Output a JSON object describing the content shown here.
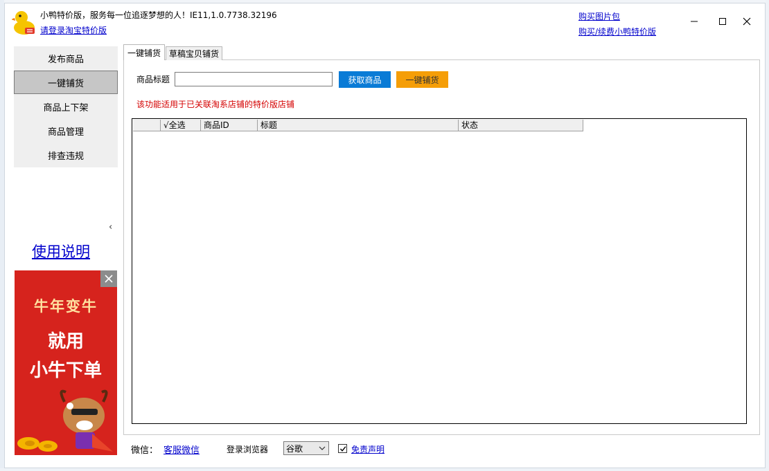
{
  "window": {
    "title": "小鸭特价版，服务每一位追逐梦想的人！IE11,1.0.7738.32196",
    "login_link": "请登录淘宝特价版",
    "buy_image_pack": "购买图片包",
    "buy_renew": "购买/续费小鸭特价版"
  },
  "sidebar": {
    "items": [
      {
        "label": "发布商品"
      },
      {
        "label": "一键铺货"
      },
      {
        "label": "商品上下架"
      },
      {
        "label": "商品管理"
      },
      {
        "label": "排查违规"
      }
    ],
    "active_index": 1,
    "collapse_icon": "‹",
    "help_link": "使用说明"
  },
  "ad": {
    "line1": "牛年变牛",
    "line2": "就用",
    "line3": "小牛下单"
  },
  "tabs": [
    {
      "label": "一键铺货"
    },
    {
      "label": "草稿宝贝铺货"
    }
  ],
  "form": {
    "title_label": "商品标题",
    "title_value": "",
    "fetch_button": "获取商品",
    "stock_button": "一键铺货",
    "note": "该功能适用于已关联淘系店铺的特价版店铺"
  },
  "table": {
    "columns": [
      "",
      "√全选",
      "商品ID",
      "标题",
      "状态"
    ],
    "rows": []
  },
  "footer": {
    "wechat_label": "微信：",
    "service_link": "客服微信",
    "browser_label": "登录浏览器",
    "browser_value": "谷歌",
    "disclaimer_checked": true,
    "disclaimer": "免责声明"
  },
  "colors": {
    "fetch_button": "#0a7bd6",
    "stock_button": "#f59e08",
    "note": "#d40000",
    "link": "#0000cc",
    "ad_background": "#d6231d"
  }
}
